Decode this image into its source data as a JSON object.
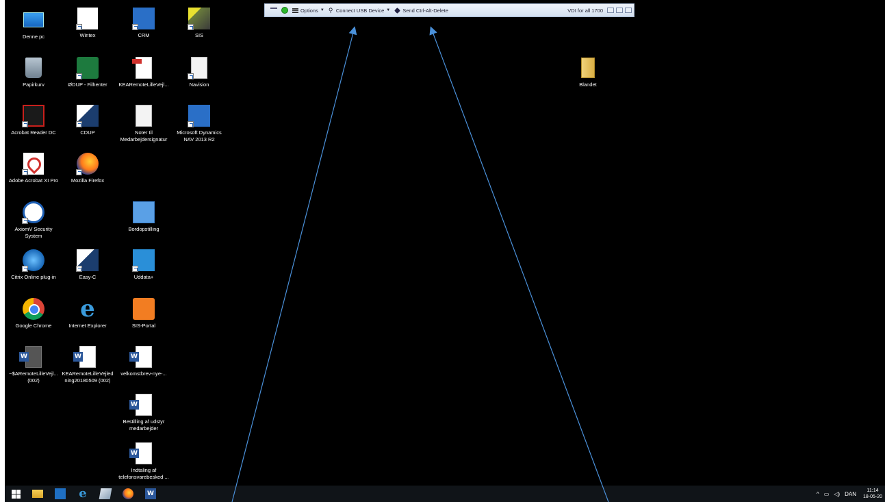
{
  "desktop": {
    "icons": [
      {
        "label": "Denne pc",
        "icon": "computer-icon"
      },
      {
        "label": "Wintex",
        "icon": "wintex-icon"
      },
      {
        "label": "CRM",
        "icon": "crm-icon"
      },
      {
        "label": "SIS",
        "icon": "sis-icon"
      },
      {
        "label": "Papirkurv",
        "icon": "recycle-bin-icon"
      },
      {
        "label": "ØDUP - Filhenter",
        "icon": "filhenter-icon"
      },
      {
        "label": "KEARemoteLilleVejl...",
        "icon": "pdf-document-icon"
      },
      {
        "label": "Navision",
        "icon": "blank-document-icon"
      },
      {
        "label": "Acrobat Reader DC",
        "icon": "acrobat-reader-icon"
      },
      {
        "label": "CDUP",
        "icon": "cdup-icon"
      },
      {
        "label": "Noter til\nMedarbejdersignatur",
        "icon": "text-document-icon"
      },
      {
        "label": "Microsoft Dynamics\nNAV 2013 R2",
        "icon": "dynamics-nav-icon"
      },
      {
        "label": "Adobe Acrobat XI Pro",
        "icon": "acrobat-pro-icon"
      },
      {
        "label": "Mozilla Firefox",
        "icon": "firefox-icon"
      },
      {
        "label": "AxiomV Security\nSystem",
        "icon": "globe-icon"
      },
      {
        "label": "Bordopstilling",
        "icon": "image-icon"
      },
      {
        "label": "Citrix Online plug-in",
        "icon": "citrix-icon"
      },
      {
        "label": "Easy-C",
        "icon": "easy-c-icon"
      },
      {
        "label": "Uddata+",
        "icon": "uddata-icon"
      },
      {
        "label": "Google Chrome",
        "icon": "chrome-icon"
      },
      {
        "label": "Internet Explorer",
        "icon": "internet-explorer-icon"
      },
      {
        "label": "SIS-Portal",
        "icon": "xampp-icon"
      },
      {
        "label": "~$ARemoteLilleVejl...\n(002)",
        "icon": "word-temp-icon"
      },
      {
        "label": "KEARemoteLilleVejled\nning20180509 (002)",
        "icon": "word-document-icon"
      },
      {
        "label": "velkomstbrev-nye-...",
        "icon": "word-document-icon"
      },
      {
        "label": "Bestilling af udstyr\nmedarbejder",
        "icon": "word-document-icon"
      },
      {
        "label": "Indtaling af\ntelefonsvarebesked ...",
        "icon": "word-document-icon"
      },
      {
        "label": "Blandet",
        "icon": "folder-icon"
      }
    ]
  },
  "remote_toolbar": {
    "options_label": "Options",
    "usb_label": "Connect USB Device",
    "cad_label": "Send Ctrl-Alt-Delete",
    "session_title": "VDI for all 1700"
  },
  "taskbar": {
    "pinned": [
      "start-icon",
      "file-explorer-icon",
      "outlook-icon",
      "internet-explorer-icon",
      "pencil-app-icon",
      "firefox-icon",
      "word-icon"
    ],
    "tray": {
      "language": "DAN",
      "time": "11:14",
      "date": "18-05-20"
    }
  },
  "colors": {
    "desktop_bg": "#000000",
    "taskbar_bg": "#101418",
    "toolbar_bg": "#dfe8f3",
    "arrow": "#4a90d9"
  }
}
